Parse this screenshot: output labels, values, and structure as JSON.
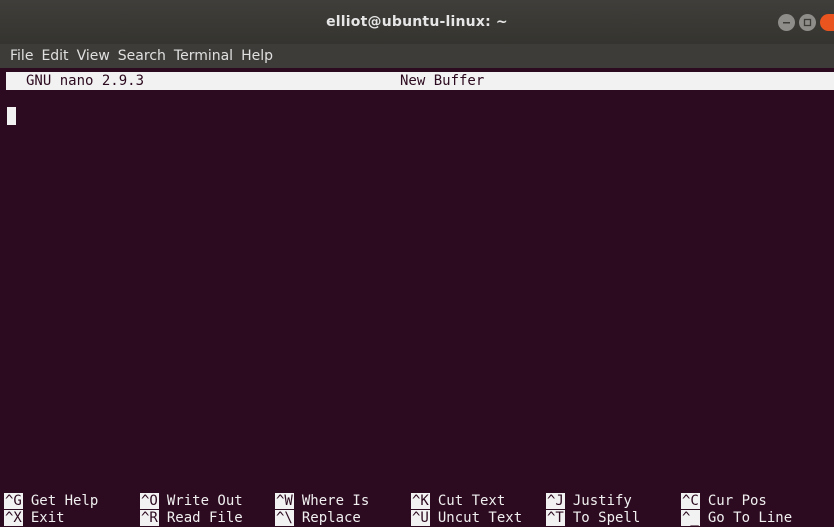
{
  "window": {
    "title": "elliot@ubuntu-linux: ~"
  },
  "menu": [
    "File",
    "Edit",
    "View",
    "Search",
    "Terminal",
    "Help"
  ],
  "nano": {
    "version": "GNU nano 2.9.3",
    "buffer": "New Buffer"
  },
  "shortcuts": {
    "row1": [
      {
        "key": "^G",
        "label": "Get Help"
      },
      {
        "key": "^O",
        "label": "Write Out"
      },
      {
        "key": "^W",
        "label": "Where Is"
      },
      {
        "key": "^K",
        "label": "Cut Text"
      },
      {
        "key": "^J",
        "label": "Justify"
      },
      {
        "key": "^C",
        "label": "Cur Pos"
      }
    ],
    "row2": [
      {
        "key": "^X",
        "label": "Exit"
      },
      {
        "key": "^R",
        "label": "Read File"
      },
      {
        "key": "^\\",
        "label": "Replace"
      },
      {
        "key": "^U",
        "label": "Uncut Text"
      },
      {
        "key": "^T",
        "label": "To Spell"
      },
      {
        "key": "^_",
        "label": "Go To Line"
      }
    ]
  }
}
